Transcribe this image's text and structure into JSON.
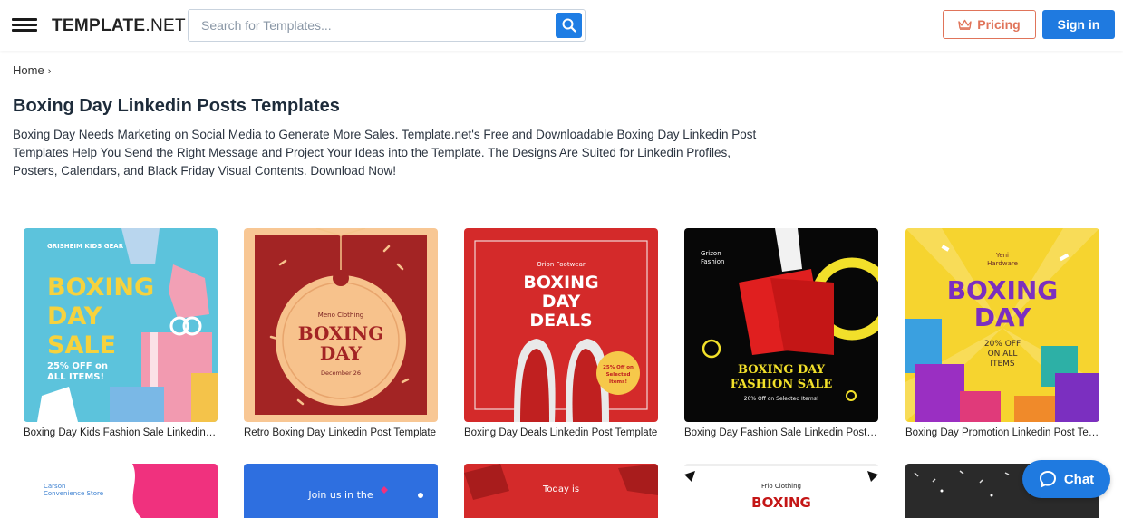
{
  "header": {
    "logo_bold": "TEMPLATE",
    "logo_suffix": ".NET",
    "search_placeholder": "Search for Templates...",
    "pricing_label": "Pricing",
    "signin_label": "Sign in"
  },
  "breadcrumb": {
    "home": "Home",
    "separator": "›"
  },
  "page": {
    "title": "Boxing Day Linkedin Posts Templates",
    "description": "Boxing Day Needs Marketing on Social Media to Generate More Sales. Template.net's Free and Downloadable Boxing Day Linkedin Post Templates Help You Send the Right Message and Project Your Ideas into the Template. The Designs Are Suited for Linkedin Profiles, Posters, Calendars, and Black Friday Visual Contents. Download Now!"
  },
  "cards": [
    {
      "caption": "Boxing Day Kids Fashion Sale Linkedin Post Template",
      "brand": "GRISHEIM KIDS GEAR",
      "line1": "BOXING",
      "line2": "DAY",
      "line3": "SALE",
      "offer1": "25% OFF on",
      "offer2": "ALL ITEMS!"
    },
    {
      "caption": "Retro Boxing Day Linkedin Post Template",
      "brand": "Meno Clothing",
      "line1": "BOXING",
      "line2": "DAY",
      "date": "December 26"
    },
    {
      "caption": "Boxing Day Deals Linkedin Post Template",
      "brand": "Orion Footwear",
      "line1": "BOXING",
      "line2": "DAY",
      "line3": "DEALS",
      "badge1": "25% Off on",
      "badge2": "Selected",
      "badge3": "Items!"
    },
    {
      "caption": "Boxing Day Fashion Sale Linkedin Post Template",
      "brand1": "Grizon",
      "brand2": "Fashion",
      "line1": "BOXING DAY",
      "line2": "FASHION SALE",
      "offer": "20% Off on Selected Items!"
    },
    {
      "caption": "Boxing Day Promotion Linkedin Post Template",
      "brand1": "Yeni",
      "brand2": "Hardware",
      "line1": "BOXING",
      "line2": "DAY",
      "offer1": "20% OFF",
      "offer2": "ON ALL",
      "offer3": "ITEMS"
    }
  ],
  "row2": [
    {
      "brand1": "Carson",
      "brand2": "Convenience Store"
    },
    {
      "text": "Join us in the"
    },
    {
      "text": "Today is"
    },
    {
      "brand": "Frio Clothing",
      "text": "BOXING"
    },
    {
      "text": ""
    }
  ],
  "chat": {
    "label": "Chat"
  },
  "colors": {
    "primary": "#1f7ae0",
    "pricing": "#e0745a"
  }
}
